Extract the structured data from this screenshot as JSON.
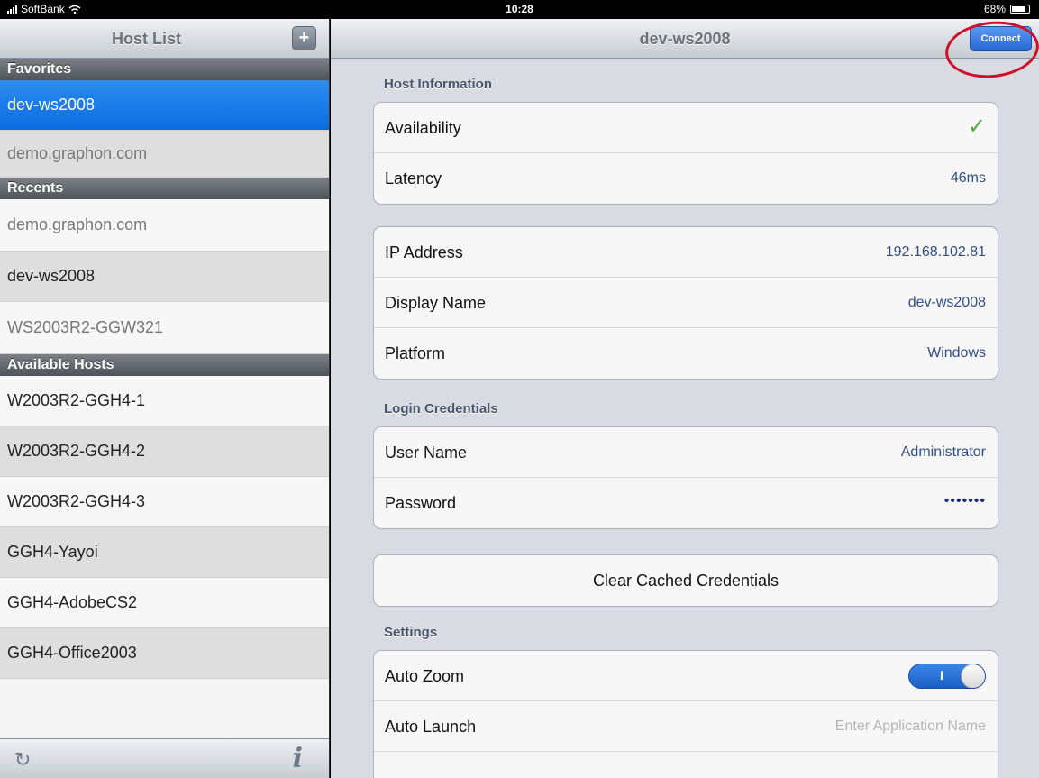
{
  "statusbar": {
    "carrier": "SoftBank",
    "time": "10:28",
    "battery": "68%"
  },
  "left": {
    "title": "Host List",
    "add_label": "+",
    "sections": {
      "favorites": "Favorites",
      "recents": "Recents",
      "available": "Available Hosts"
    },
    "favorites": [
      "dev-ws2008",
      "demo.graphon.com"
    ],
    "recents": [
      "demo.graphon.com",
      "dev-ws2008",
      "WS2003R2-GGW321"
    ],
    "available": [
      "W2003R2-GGH4-1",
      "W2003R2-GGH4-2",
      "W2003R2-GGH4-3",
      "GGH4-Yayoi",
      "GGH4-AdobeCS2",
      "GGH4-Office2003"
    ],
    "refresh_icon": "refresh-icon",
    "info_icon": "info-icon"
  },
  "right": {
    "title": "dev-ws2008",
    "connect_label": "Connect",
    "host_info_header": "Host Information",
    "availability_label": "Availability",
    "availability_value": "✓",
    "latency_label": "Latency",
    "latency_value": "46ms",
    "ip_label": "IP Address",
    "ip_value": "192.168.102.81",
    "display_name_label": "Display Name",
    "display_name_value": "dev-ws2008",
    "platform_label": "Platform",
    "platform_value": "Windows",
    "login_header": "Login Credentials",
    "username_label": "User Name",
    "username_value": "Administrator",
    "password_label": "Password",
    "password_value": "•••••••",
    "clear_button": "Clear Cached Credentials",
    "settings_header": "Settings",
    "auto_zoom_label": "Auto Zoom",
    "auto_zoom_on": "I",
    "auto_launch_label": "Auto Launch",
    "auto_launch_placeholder": "Enter Application Name"
  },
  "colors": {
    "selected": "#0a6de0",
    "connect": "#2866d6",
    "highlight": "#d0102a",
    "check": "#4caa35"
  }
}
